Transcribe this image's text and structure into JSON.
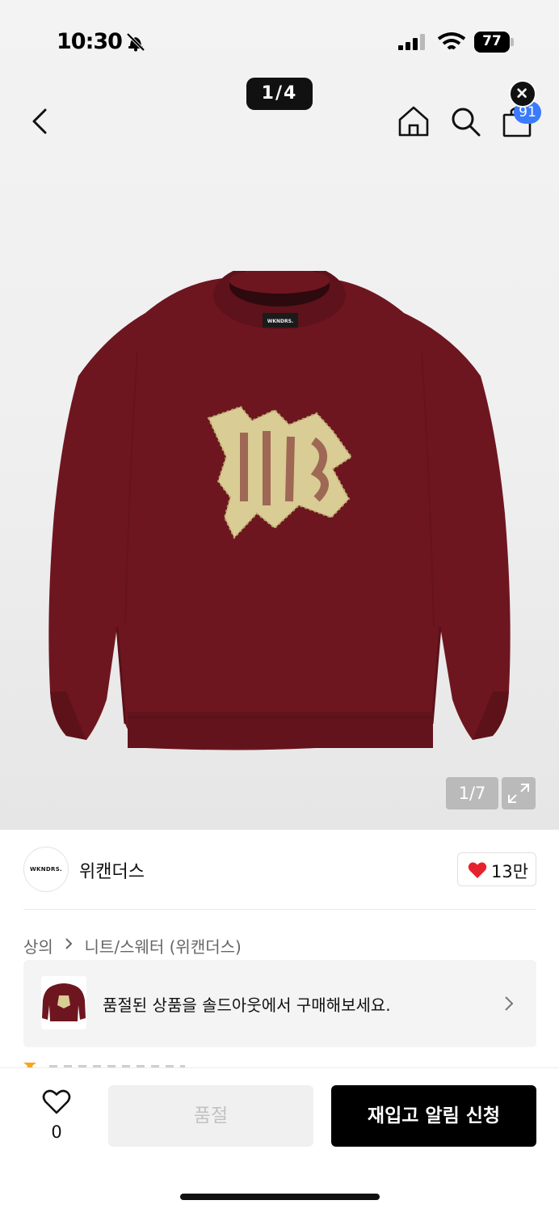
{
  "status_bar": {
    "time": "10:30",
    "battery": "77"
  },
  "nav": {
    "image_pager": "1/4",
    "cart_count": "91"
  },
  "gallery": {
    "counter": "1/7"
  },
  "product": {
    "graphic_text": "WB",
    "label_text": "WKNDRS."
  },
  "brand": {
    "logo_text": "WKNDRS.",
    "name": "위캔더스",
    "likes": "13만"
  },
  "breadcrumb": {
    "level1": "상의",
    "level2": "니트/스웨터 (위캔더스)"
  },
  "banner": {
    "text": "품절된 상품을 솔드아웃에서 구매해보세요."
  },
  "bottom": {
    "wish_count": "0",
    "soldout_label": "품절",
    "restock_label": "재입고 알림 신청"
  },
  "colors": {
    "sweater": "#6e1620",
    "graphic": "#d9cc94",
    "badge": "#3a7bff",
    "heart": "#e5232e"
  },
  "icons": [
    "bell-slash-icon",
    "signal-icon",
    "wifi-icon",
    "back-icon",
    "home-icon",
    "search-icon",
    "cart-icon",
    "close-icon",
    "expand-icon",
    "heart-icon",
    "chevron-right-icon"
  ]
}
